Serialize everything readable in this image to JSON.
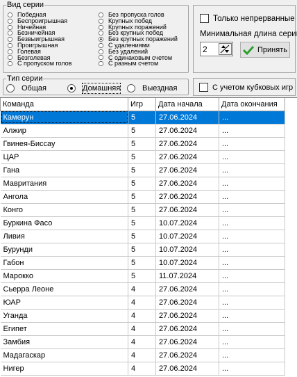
{
  "series_type_group": {
    "title": "Вид серии",
    "options_left": [
      {
        "label": "Победная",
        "selected": false
      },
      {
        "label": "Беспроигрышная",
        "selected": false
      },
      {
        "label": "Ничейная",
        "selected": false
      },
      {
        "label": "Безничейная",
        "selected": false
      },
      {
        "label": "Безвыигрышная",
        "selected": false
      },
      {
        "label": "Проигрышная",
        "selected": false
      },
      {
        "label": "Голевая",
        "selected": false
      },
      {
        "label": "Безголевая",
        "selected": false
      },
      {
        "label": "С пропуском голов",
        "selected": false
      }
    ],
    "options_right": [
      {
        "label": "Без пропуска голов",
        "selected": false
      },
      {
        "label": "Крупных побед",
        "selected": false
      },
      {
        "label": "Крупных поражений",
        "selected": false
      },
      {
        "label": "Без крупных побед",
        "selected": false
      },
      {
        "label": "Без крупных поражений",
        "selected": true
      },
      {
        "label": "С удалениями",
        "selected": false
      },
      {
        "label": "Без удалений",
        "selected": false
      },
      {
        "label": "С одинаковым счетом",
        "selected": false
      },
      {
        "label": "С разным счетом",
        "selected": false
      }
    ]
  },
  "options_panel": {
    "continuous_label": "Только непрерванные",
    "continuous_checked": false,
    "min_length_label": "Минимальная длина серии",
    "min_length_value": "2",
    "apply_label": "Принять"
  },
  "match_type_group": {
    "title": "Тип серии",
    "options": [
      {
        "label": "Общая",
        "selected": false
      },
      {
        "label": "Домашняя",
        "selected": true
      },
      {
        "label": "Выездная",
        "selected": false
      }
    ]
  },
  "cup_games": {
    "label": "С учетом кубковых игр",
    "checked": false
  },
  "table": {
    "headers": [
      "Команда",
      "Игр",
      "Дата начала",
      "Дата окончания"
    ],
    "rows": [
      {
        "team": "Камерун",
        "games": "5",
        "start": "27.06.2024",
        "end": "..."
      },
      {
        "team": "Алжир",
        "games": "5",
        "start": "27.06.2024",
        "end": "..."
      },
      {
        "team": "Гвинея-Биссау",
        "games": "5",
        "start": "27.06.2024",
        "end": "..."
      },
      {
        "team": "ЦАР",
        "games": "5",
        "start": "27.06.2024",
        "end": "..."
      },
      {
        "team": "Гана",
        "games": "5",
        "start": "27.06.2024",
        "end": "..."
      },
      {
        "team": "Мавритания",
        "games": "5",
        "start": "27.06.2024",
        "end": "..."
      },
      {
        "team": "Ангола",
        "games": "5",
        "start": "27.06.2024",
        "end": "..."
      },
      {
        "team": "Конго",
        "games": "5",
        "start": "27.06.2024",
        "end": "..."
      },
      {
        "team": "Буркина Фасо",
        "games": "5",
        "start": "10.07.2024",
        "end": "..."
      },
      {
        "team": "Ливия",
        "games": "5",
        "start": "10.07.2024",
        "end": "..."
      },
      {
        "team": "Бурунди",
        "games": "5",
        "start": "10.07.2024",
        "end": "..."
      },
      {
        "team": "Габон",
        "games": "5",
        "start": "10.07.2024",
        "end": "..."
      },
      {
        "team": "Марокко",
        "games": "5",
        "start": "11.07.2024",
        "end": "..."
      },
      {
        "team": "Сьерра Леоне",
        "games": "4",
        "start": "27.06.2024",
        "end": "..."
      },
      {
        "team": "ЮАР",
        "games": "4",
        "start": "27.06.2024",
        "end": "..."
      },
      {
        "team": "Уганда",
        "games": "4",
        "start": "27.06.2024",
        "end": "..."
      },
      {
        "team": "Египет",
        "games": "4",
        "start": "27.06.2024",
        "end": "..."
      },
      {
        "team": "Замбия",
        "games": "4",
        "start": "27.06.2024",
        "end": "..."
      },
      {
        "team": "Мадагаскар",
        "games": "4",
        "start": "27.06.2024",
        "end": "..."
      },
      {
        "team": "Нигер",
        "games": "4",
        "start": "27.06.2024",
        "end": "..."
      }
    ],
    "selected_index": 0
  },
  "icons": {
    "spin": "spin-updown-icon",
    "apply": "green-checkmark-icon"
  },
  "colors": {
    "selection": "#0078d7",
    "check": "#2ea02e"
  }
}
